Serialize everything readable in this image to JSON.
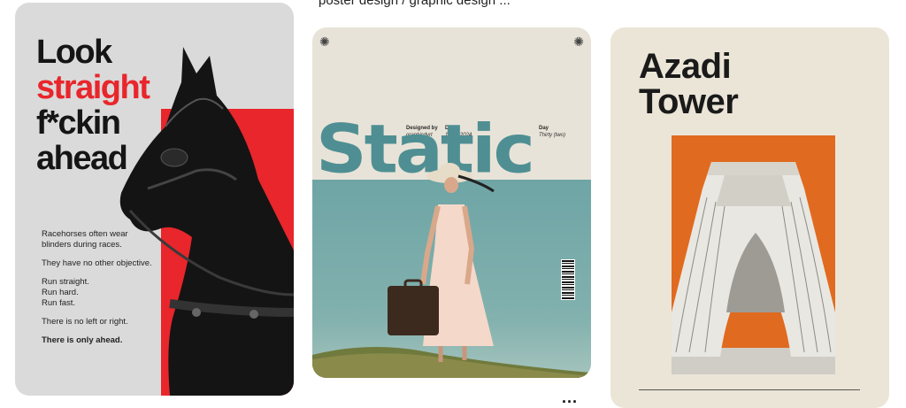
{
  "caption": "poster design / graphic design ...",
  "card1": {
    "headline": [
      "Look",
      "straight",
      "f*ckin",
      "ahead"
    ],
    "paragraphs": [
      "Racehorses often wear blinders during races.",
      "They have no other objective.",
      "Run straight. Run hard. Run fast.",
      "There is no left or right.",
      "There is only ahead."
    ],
    "colors": {
      "accent": "#e8262b",
      "bg": "#dadada"
    }
  },
  "card2": {
    "title": "Static",
    "meta": [
      {
        "label": "Designed by",
        "value": "graphicdyrt"
      },
      {
        "label": "Date",
        "value": "10-11-2024"
      },
      {
        "label": "Day",
        "value": "Thirty (two)"
      }
    ],
    "swirl_glyph": "✺",
    "colors": {
      "title": "#4f8f93",
      "sky": "#6fa5a6"
    }
  },
  "card3": {
    "title_line1": "Azadi",
    "title_line2": "Tower",
    "colors": {
      "accent": "#e06a1f",
      "bg": "#ebe5d7"
    }
  },
  "more_glyph": "..."
}
